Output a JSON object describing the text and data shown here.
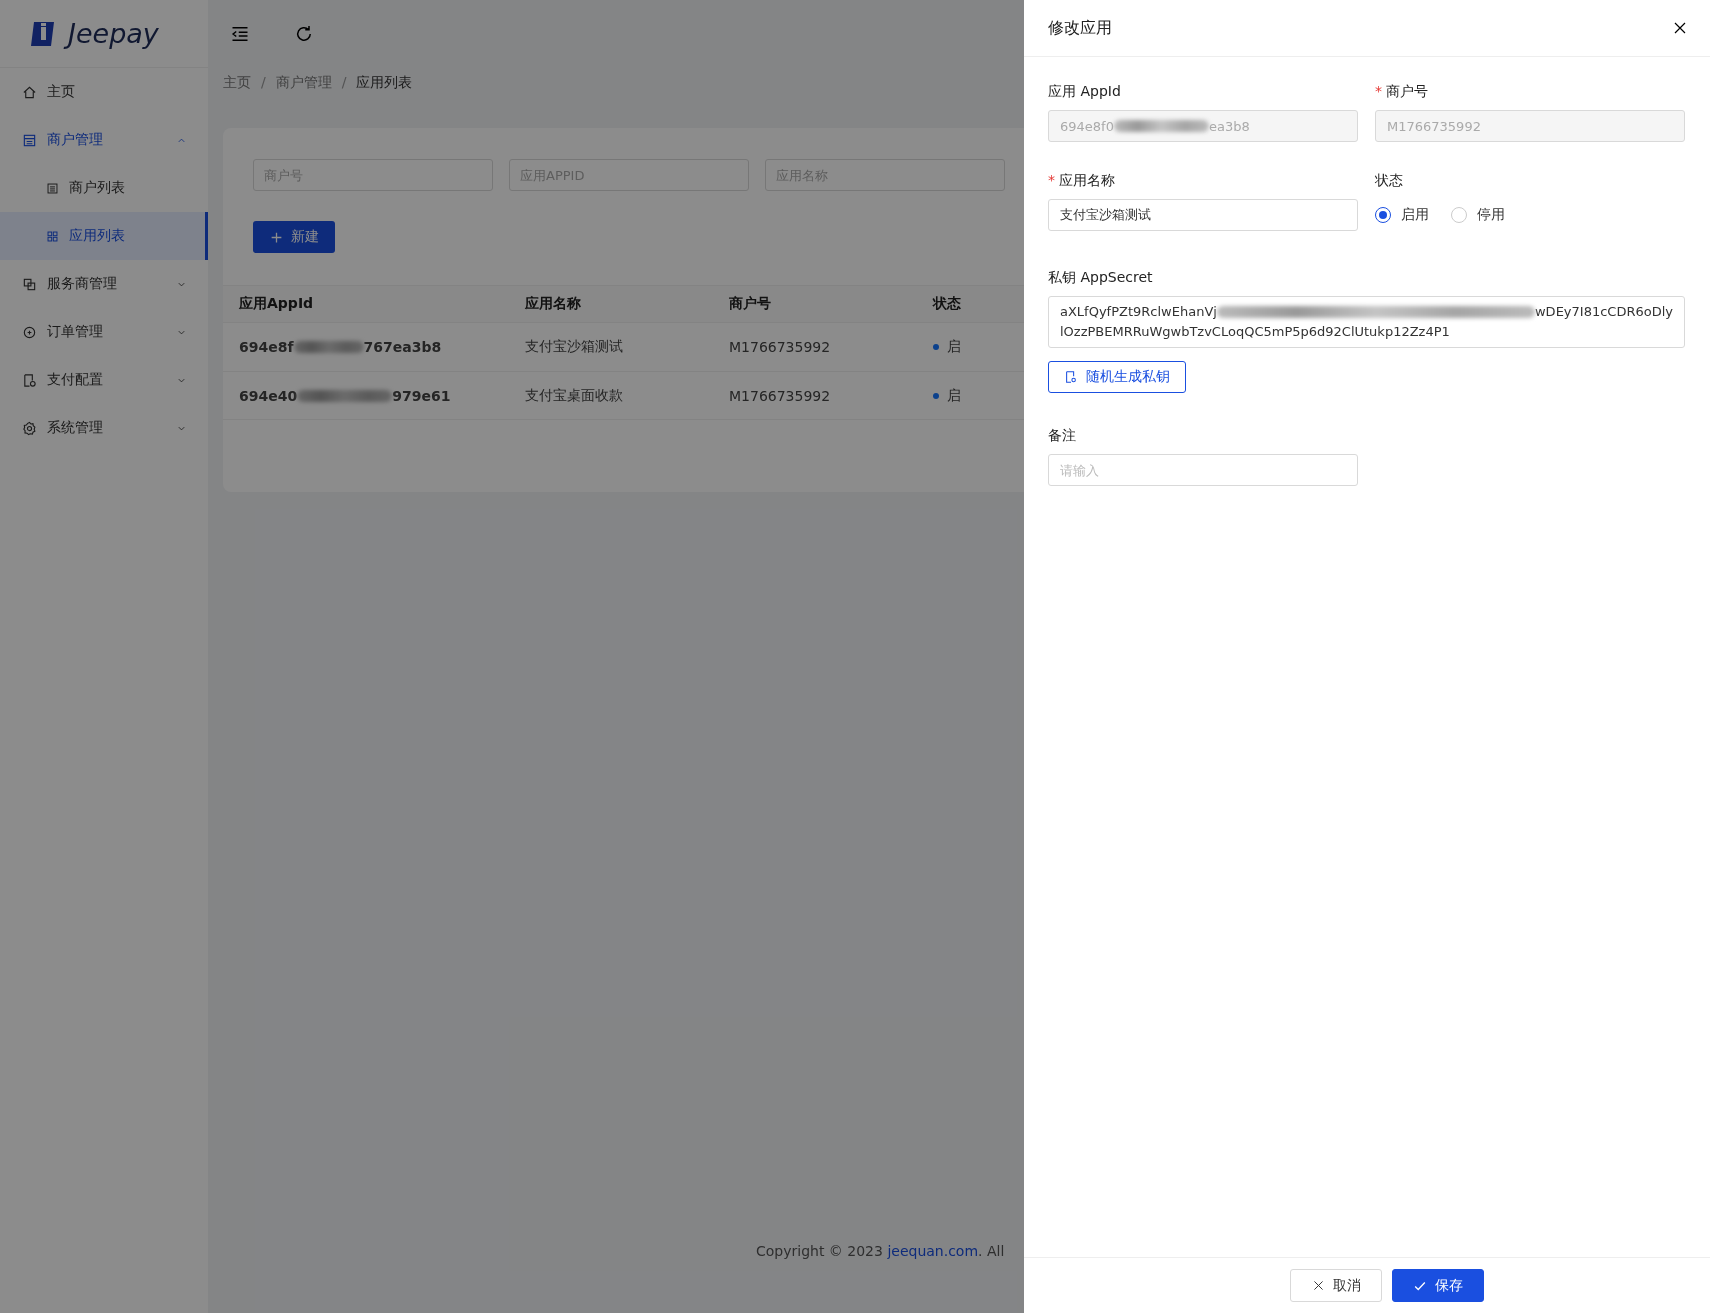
{
  "sidebar": {
    "logo": "Jeepay",
    "items": [
      {
        "label": "主页",
        "selected": false
      },
      {
        "label": "商户管理",
        "selected": true,
        "expanded": true,
        "children": [
          {
            "label": "商户列表",
            "selected": false
          },
          {
            "label": "应用列表",
            "selected": true
          }
        ]
      },
      {
        "label": "服务商管理",
        "selected": false,
        "expanded": false
      },
      {
        "label": "订单管理",
        "selected": false,
        "expanded": false
      },
      {
        "label": "支付配置",
        "selected": false,
        "expanded": false
      },
      {
        "label": "系统管理",
        "selected": false,
        "expanded": false
      }
    ]
  },
  "breadcrumb": {
    "separator": "/",
    "items": [
      "主页",
      "商户管理",
      "应用列表"
    ]
  },
  "filters": [
    {
      "placeholder": "商户号"
    },
    {
      "placeholder": "应用APPID"
    },
    {
      "placeholder": "应用名称"
    }
  ],
  "new_button": "新建",
  "table": {
    "columns": [
      "应用AppId",
      "应用名称",
      "商户号",
      "状态"
    ],
    "rows": [
      {
        "appid_start": "694e8f",
        "appid_end": "767ea3b8",
        "name": "支付宝沙箱测试",
        "merchant": "M1766735992",
        "status": "启"
      },
      {
        "appid_start": "694e40",
        "appid_end": "979e61",
        "name": "支付宝桌面收款",
        "merchant": "M1766735992",
        "status": "启"
      }
    ]
  },
  "footer": {
    "copyright": "Copyright © 2023 ",
    "link": "jeequan.com",
    "rest": ". All"
  },
  "drawer": {
    "title": "修改应用",
    "appid": {
      "label": "应用 AppId",
      "value_start": "694e8f0",
      "value_end": "ea3b8"
    },
    "merchant": {
      "label": "商户号",
      "required_mark": "*",
      "value": "M1766735992",
      "disabled": true
    },
    "name": {
      "label": "应用名称",
      "required_mark": "*",
      "value": "支付宝沙箱测试"
    },
    "status": {
      "label": "状态",
      "options": [
        {
          "label": "启用",
          "selected": true
        },
        {
          "label": "停用",
          "selected": false
        }
      ]
    },
    "secret": {
      "label": "私钥 AppSecret",
      "line1_start": "aXLfQyfPZt9RclwEhanVj",
      "line1_end": "wDEy7I81cCDR6oDly",
      "line2": "lOzzPBEMRRuWgwbTzvCLoqQC5mP5p6d92ClUtukp12Zz4P1"
    },
    "generate_button": "随机生成私钥",
    "remark": {
      "label": "备注",
      "placeholder": "请输入"
    },
    "buttons": [
      {
        "label": "取消",
        "kind": "cancel"
      },
      {
        "label": "保存",
        "kind": "save"
      }
    ]
  }
}
